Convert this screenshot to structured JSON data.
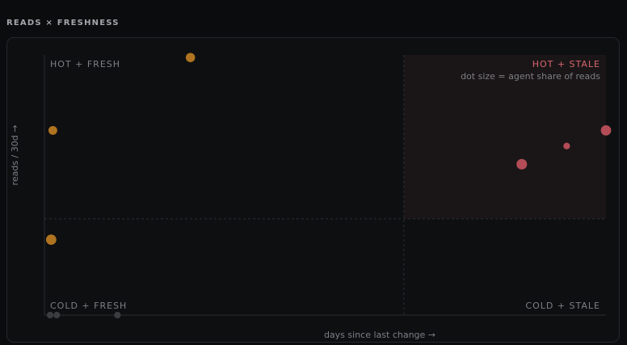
{
  "header": {
    "title": "READS × FRESHNESS"
  },
  "quadrants": {
    "hot_fresh": "HOT + FRESH",
    "hot_stale": "HOT + STALE",
    "cold_fresh": "COLD + FRESH",
    "cold_stale": "COLD + STALE"
  },
  "note": "dot size = agent share of reads",
  "colors": {
    "fresh": "#b07420",
    "stale": "#c4525d",
    "muted": "#3a3c40",
    "hot_stale_bg": "#1a1617"
  },
  "chart_data": {
    "type": "scatter",
    "xlabel": "days since last change →",
    "ylabel": "reads / 30d →",
    "xlim": [
      0,
      100
    ],
    "ylim": [
      0,
      100
    ],
    "thresholds": {
      "x": 64,
      "y": 37
    },
    "grid": false,
    "points": [
      {
        "x": 26,
        "y": 99,
        "size": 0.5,
        "group": "fresh"
      },
      {
        "x": 1.5,
        "y": 71,
        "size": 0.45,
        "group": "fresh"
      },
      {
        "x": 1.2,
        "y": 29,
        "size": 0.6,
        "group": "fresh"
      },
      {
        "x": 100,
        "y": 71,
        "size": 0.6,
        "group": "stale"
      },
      {
        "x": 93,
        "y": 65,
        "size": 0.25,
        "group": "stale"
      },
      {
        "x": 85,
        "y": 58,
        "size": 0.62,
        "group": "stale"
      },
      {
        "x": 1,
        "y": 0,
        "size": 0.25,
        "group": "muted"
      },
      {
        "x": 2.2,
        "y": 0,
        "size": 0.25,
        "group": "muted"
      },
      {
        "x": 13,
        "y": 0,
        "size": 0.25,
        "group": "muted"
      }
    ]
  }
}
